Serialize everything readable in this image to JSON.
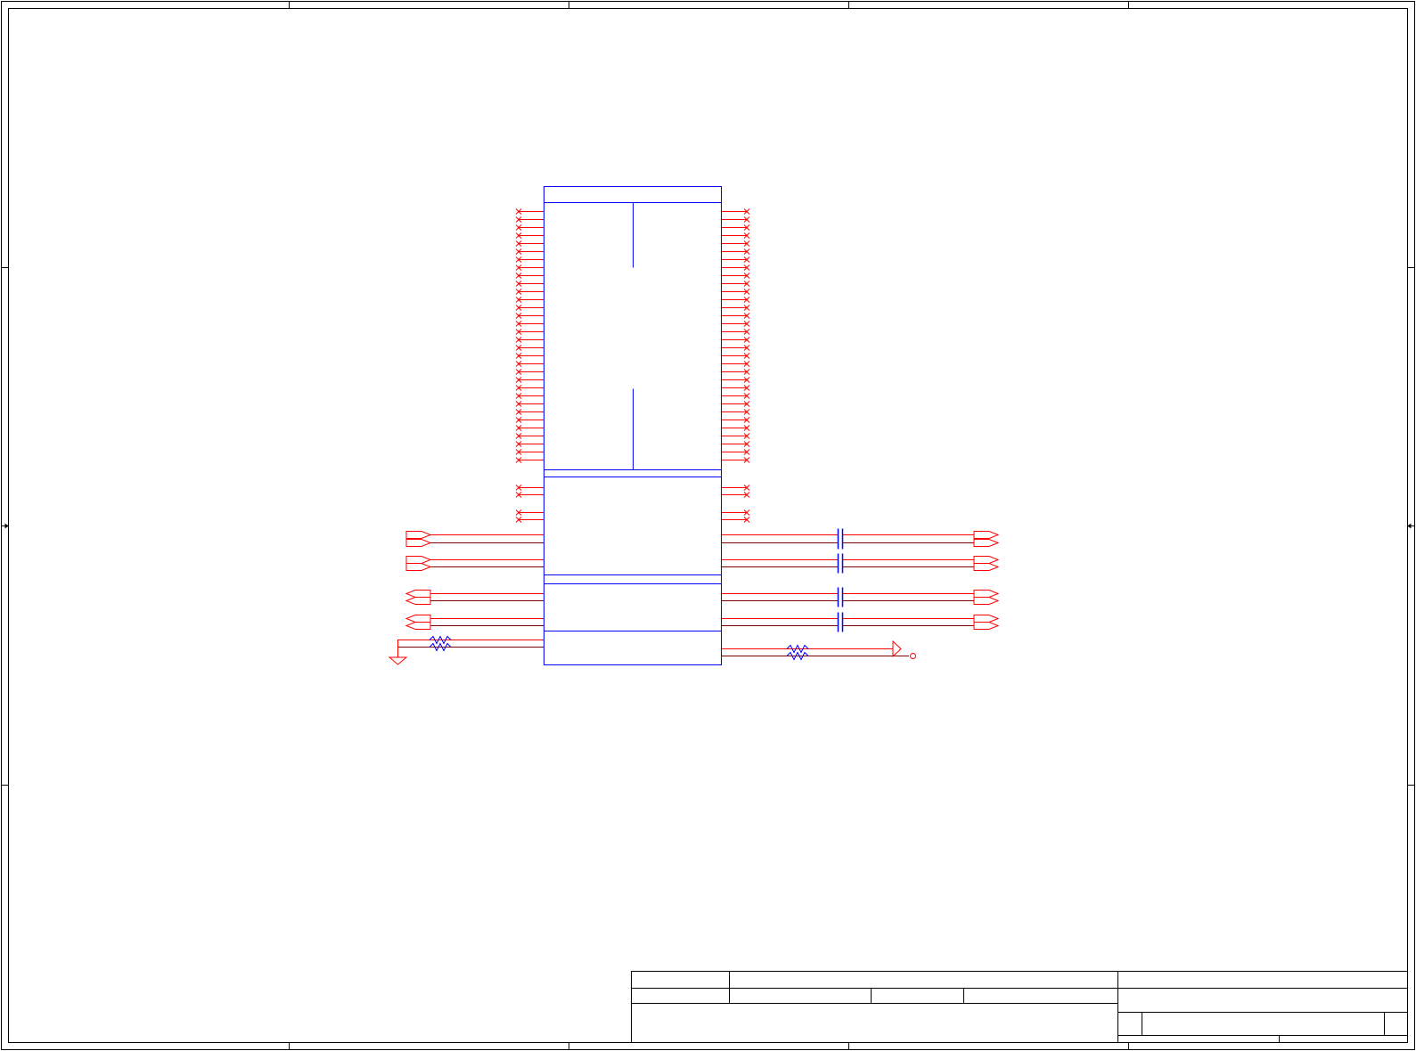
{
  "sheet": {
    "title": "",
    "frame_color": "#000000",
    "component_color": "#0000ff",
    "wire_color": "#ff0000",
    "net_color": "#800000",
    "zones": {
      "columns": 5,
      "rows": 3
    }
  },
  "component": {
    "reference": "",
    "value": "",
    "sections": 5,
    "left_nc_pins_bank1": 32,
    "right_nc_pins_bank1": 32,
    "left_nc_pins_bank2": 4,
    "right_nc_pins_bank2": 4
  },
  "ports": {
    "left_inputs": 4,
    "left_outputs": 4,
    "right_ports": 8
  },
  "passives": {
    "resistors": 2,
    "capacitors": 4
  },
  "power": {
    "ground_symbols": 1,
    "power_flags": 1
  },
  "title_block": {
    "title": "",
    "size": "",
    "document_number": "",
    "revision": "",
    "date": "",
    "sheet": ""
  }
}
